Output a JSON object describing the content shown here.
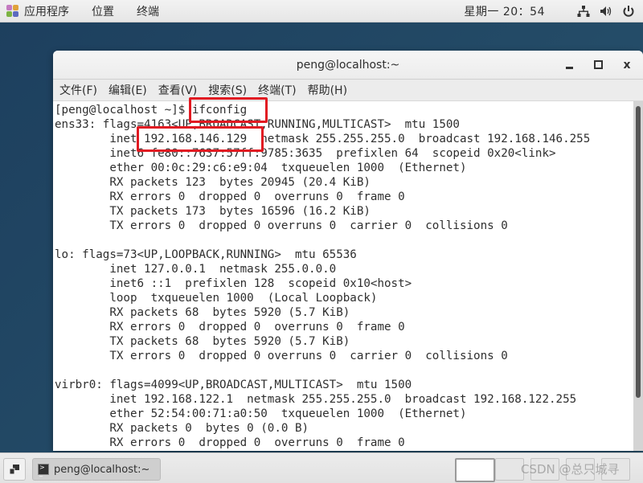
{
  "top_panel": {
    "applications": "应用程序",
    "places": "位置",
    "terminal": "终端",
    "clock": "星期一 20：54",
    "icons": [
      "network-icon",
      "volume-icon",
      "power-icon"
    ]
  },
  "window": {
    "title": "peng@localhost:~",
    "controls": [
      "minimize",
      "maximize",
      "close"
    ],
    "close_glyph": "x",
    "menu": [
      "文件(F)",
      "编辑(E)",
      "查看(V)",
      "搜索(S)",
      "终端(T)",
      "帮助(H)"
    ]
  },
  "terminal": {
    "lines": [
      "[peng@localhost ~]$ ifconfig",
      "ens33: flags=4163<UP,BROADCAST,RUNNING,MULTICAST>  mtu 1500",
      "        inet 192.168.146.129  netmask 255.255.255.0  broadcast 192.168.146.255",
      "        inet6 fe80::7637:57ff:9785:3635  prefixlen 64  scopeid 0x20<link>",
      "        ether 00:0c:29:c6:e9:04  txqueuelen 1000  (Ethernet)",
      "        RX packets 123  bytes 20945 (20.4 KiB)",
      "        RX errors 0  dropped 0  overruns 0  frame 0",
      "        TX packets 173  bytes 16596 (16.2 KiB)",
      "        TX errors 0  dropped 0 overruns 0  carrier 0  collisions 0",
      "",
      "lo: flags=73<UP,LOOPBACK,RUNNING>  mtu 65536",
      "        inet 127.0.0.1  netmask 255.0.0.0",
      "        inet6 ::1  prefixlen 128  scopeid 0x10<host>",
      "        loop  txqueuelen 1000  (Local Loopback)",
      "        RX packets 68  bytes 5920 (5.7 KiB)",
      "        RX errors 0  dropped 0  overruns 0  frame 0",
      "        TX packets 68  bytes 5920 (5.7 KiB)",
      "        TX errors 0  dropped 0 overruns 0  carrier 0  collisions 0",
      "",
      "virbr0: flags=4099<UP,BROADCAST,MULTICAST>  mtu 1500",
      "        inet 192.168.122.1  netmask 255.255.255.0  broadcast 192.168.122.255",
      "        ether 52:54:00:71:a0:50  txqueuelen 1000  (Ethernet)",
      "        RX packets 0  bytes 0 (0.0 B)",
      "        RX errors 0  dropped 0  overruns 0  frame 0"
    ],
    "highlights": [
      "ifconfig",
      "192.168.146.129"
    ],
    "highlight_color": "#e11a22"
  },
  "bottom_panel": {
    "task_label": "peng@localhost:~",
    "watermark": "CSDN @总只城寻"
  }
}
